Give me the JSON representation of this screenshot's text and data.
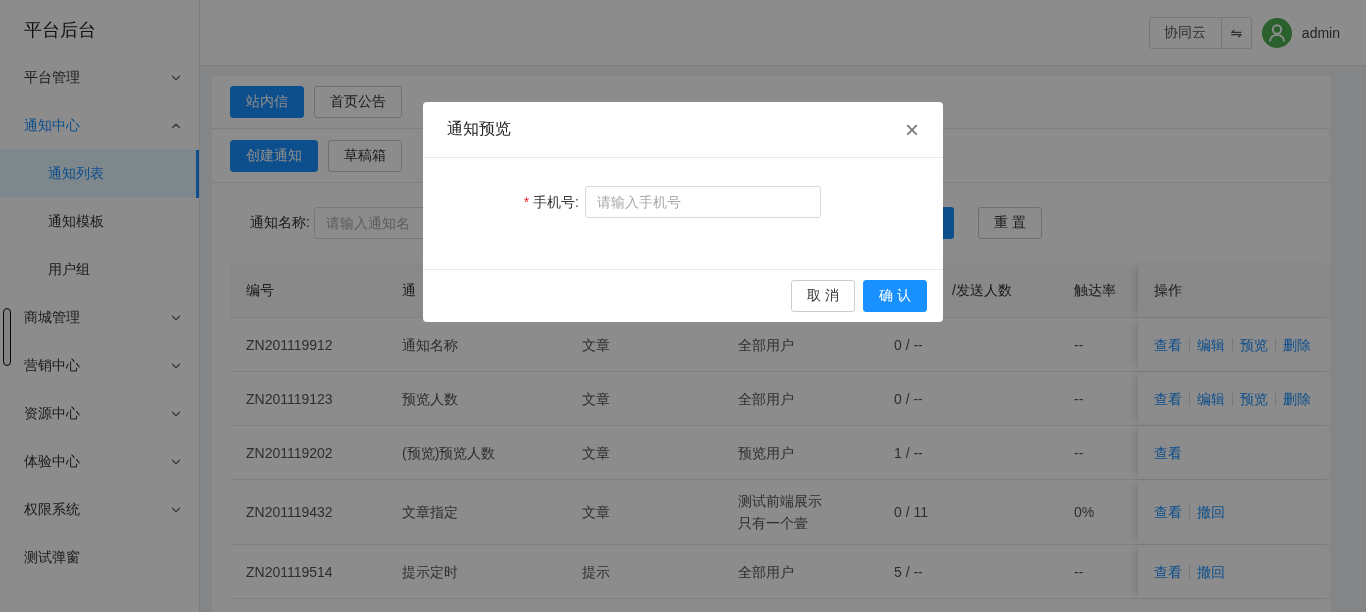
{
  "sidebar": {
    "title": "平台后台",
    "items": [
      {
        "label": "平台管理",
        "expanded": false,
        "kind": "group"
      },
      {
        "label": "通知中心",
        "expanded": true,
        "kind": "group",
        "children": [
          {
            "label": "通知列表",
            "selected": true
          },
          {
            "label": "通知模板",
            "selected": false
          },
          {
            "label": "用户组",
            "selected": false
          }
        ]
      },
      {
        "label": "商城管理",
        "expanded": false,
        "kind": "group"
      },
      {
        "label": "营销中心",
        "expanded": false,
        "kind": "group"
      },
      {
        "label": "资源中心",
        "expanded": false,
        "kind": "group"
      },
      {
        "label": "体验中心",
        "expanded": false,
        "kind": "group"
      },
      {
        "label": "权限系统",
        "expanded": false,
        "kind": "group"
      },
      {
        "label": "测试弹窗",
        "kind": "link"
      }
    ]
  },
  "header": {
    "org_button": "协同云",
    "switch_button": "⇋",
    "user": "admin"
  },
  "tabs": [
    {
      "label": "站内信",
      "selected": true
    },
    {
      "label": "首页公告",
      "selected": false
    }
  ],
  "actions": [
    {
      "label": "创建通知",
      "primary": true
    },
    {
      "label": "草稿箱",
      "primary": false
    }
  ],
  "filter": {
    "label": "通知名称:",
    "placeholder": "请输入通知名",
    "reset": "重 置"
  },
  "table": {
    "header_left": [
      "编号",
      "通"
    ],
    "header_right": [
      "/发送人数",
      "触达率",
      "操作"
    ],
    "rows": [
      {
        "cells": [
          "ZN201119912",
          "通知名称",
          "文章",
          "全部用户",
          "0 / --",
          "--"
        ],
        "actions": [
          "查看",
          "编辑",
          "预览",
          "删除"
        ]
      },
      {
        "cells": [
          "ZN201119123",
          "预览人数",
          "文章",
          "全部用户",
          "0 / --",
          "--"
        ],
        "actions": [
          "查看",
          "编辑",
          "预览",
          "删除"
        ]
      },
      {
        "cells": [
          "ZN201119202",
          "(预览)预览人数",
          "文章",
          "预览用户",
          "1 / --",
          "--"
        ],
        "actions": [
          "查看"
        ]
      },
      {
        "cells": [
          "ZN201119432",
          "文章指定",
          "文章",
          "测试前端展示只有一个壹",
          "0 / 11",
          "0%"
        ],
        "actions": [
          "查看",
          "撤回"
        ]
      },
      {
        "cells": [
          "ZN201119514",
          "提示定时",
          "提示",
          "全部用户",
          "5 / --",
          "--"
        ],
        "actions": [
          "查看",
          "撤回"
        ]
      }
    ]
  },
  "dialog": {
    "title": "通知预览",
    "close": "×",
    "required_mark": "*",
    "field_label": "手机号:",
    "placeholder": "请输入手机号",
    "cancel": "取 消",
    "confirm": "确 认"
  }
}
